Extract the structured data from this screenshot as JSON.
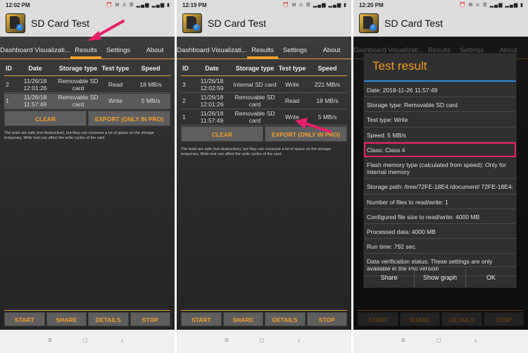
{
  "app": {
    "title": "SD Card Test",
    "logo_icon": "sd-card-icon"
  },
  "colors": {
    "accent": "#f0a030",
    "highlight": "#e8206a",
    "dialog_line": "#2f8ad8"
  },
  "tabs": [
    "Dashboard Visualizati...",
    "Results",
    "Settings",
    "About"
  ],
  "table_headers": [
    "ID",
    "Date",
    "Storage type",
    "Test type",
    "Speed"
  ],
  "buttons": {
    "clear": "CLEAR",
    "export": "EXPORT (ONLY IN PRO)"
  },
  "bottom_buttons": [
    "START",
    "SHARE",
    "DETAILS",
    "STOP"
  ],
  "note": "The tests are safe (not destructive), but they can consume a lot of space on the storage temporary. Write test can affect the write cycles of the card.",
  "nav_icons": {
    "menu": "≡",
    "home": "□",
    "back": "‹"
  },
  "screens": [
    {
      "time": "12:02 PM",
      "status_icons": "⏰ ✉ ⚠ ☰ ▂▄▆ ▂▄▆ ▮",
      "rows": [
        {
          "id": "2",
          "date": "11/26/18 12:01:26",
          "storage": "Removable SD card",
          "type": "Read",
          "speed": "18 MB/s"
        },
        {
          "id": "1",
          "date": "11/26/18 11:57:49",
          "storage": "Removable SD card",
          "type": "Write",
          "speed": "5 MB/s"
        }
      ]
    },
    {
      "time": "12:19 PM",
      "status_icons": "⏰ ✉ ⚠ ☰ ▂▄▆ ▂▄▆ ▮",
      "rows": [
        {
          "id": "3",
          "date": "11/26/18 12:02:59",
          "storage": "Internal SD card",
          "type": "Write",
          "speed": "221 MB/s"
        },
        {
          "id": "2",
          "date": "11/26/18 12:01:26",
          "storage": "Removable SD card",
          "type": "Read",
          "speed": "18 MB/s"
        },
        {
          "id": "1",
          "date": "11/26/18 11:57:49",
          "storage": "Removable SD card",
          "type": "Write",
          "speed": "5 MB/s"
        }
      ]
    },
    {
      "time": "12:20 PM",
      "status_icons": "⏰ ✉ ⚠ ☰ ▂▄▆ ▂▄▆ ▮"
    }
  ],
  "dialog": {
    "title": "Test result",
    "lines": [
      "Date: 2018-11-26 11:57:49",
      "Storage type: Removable SD card",
      "Test type: Write",
      "Speed: 5 MB/s",
      "Class: Class 4",
      "Flash memory type (calculated from speed): Only for internal memory",
      "Storage path: /tree/72FE-18E4:/document/ 72FE-18E4:",
      "Number of files to read/write: 1",
      "Configured file size to read/write: 4000 MB",
      "Processed data: 4000 MB",
      "Run time: 792 sec.",
      "Data verification status: These settings are only available in the Pro version"
    ],
    "buttons": [
      "Share",
      "Show graph",
      "OK"
    ]
  }
}
